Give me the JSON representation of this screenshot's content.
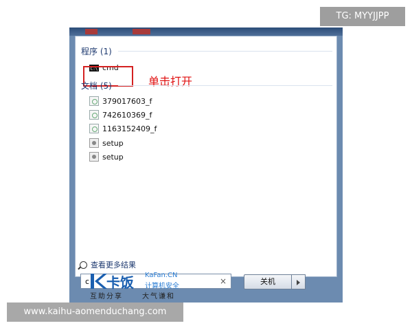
{
  "start_menu": {
    "groups": [
      {
        "header": "程序 (1)",
        "items": [
          {
            "label": "cmd",
            "icon": "console-icon"
          }
        ]
      },
      {
        "header": "文档 (5)",
        "items": [
          {
            "label": "379017603_f",
            "icon": "document-icon"
          },
          {
            "label": "742610369_f",
            "icon": "document-icon"
          },
          {
            "label": "1163152409_f",
            "icon": "document-icon"
          },
          {
            "label": "setup",
            "icon": "setup-icon"
          },
          {
            "label": "setup",
            "icon": "setup-icon"
          }
        ]
      }
    ],
    "annotation": "单击打开",
    "more_results": "查看更多结果",
    "search_value": "c",
    "clear_icon": "×",
    "shutdown_label": "关机"
  },
  "logo": {
    "cn": "卡饭",
    "en": "KaFan.CN",
    "sub": "计算机安全",
    "slogan_left": "互助分享",
    "slogan_right": "大气谦和"
  },
  "overlay": {
    "tg": "TG: MYYJJPP",
    "url": "www.kaihu-aomenduchang.com"
  },
  "colors": {
    "highlight": "#d42020",
    "annotation": "#e01010",
    "frame": "#6c8bb0",
    "group_header": "#1e3a70"
  }
}
